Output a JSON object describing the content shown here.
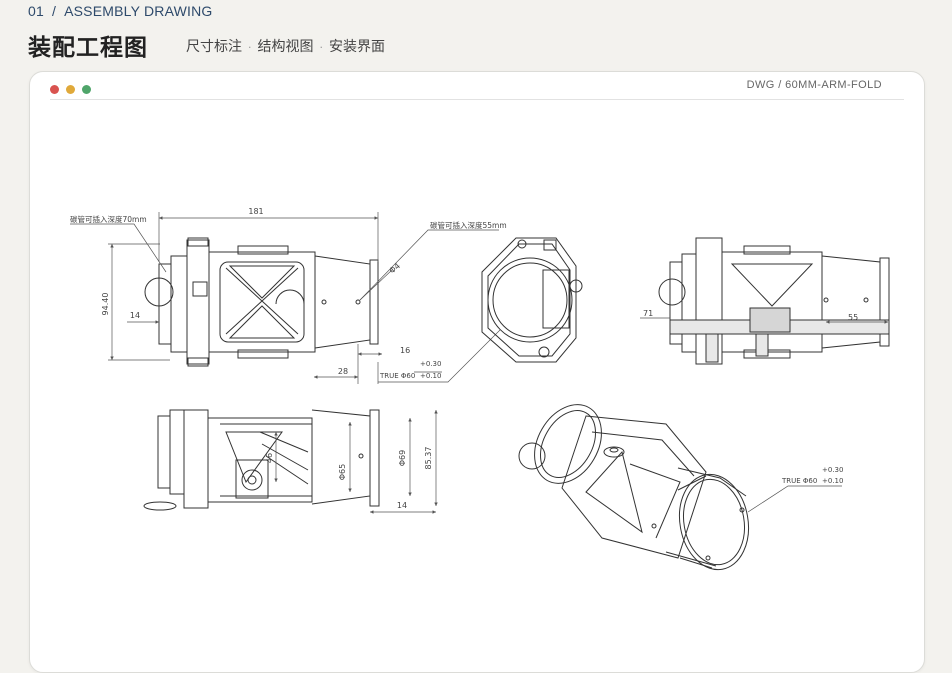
{
  "header": {
    "section_number": "01",
    "separator": "/",
    "section_label": "ASSEMBLY DRAWING",
    "title": "装配工程图",
    "subtitle_items": [
      "尺寸标注",
      "结构视图",
      "安装界面"
    ],
    "subtitle_separator": "·"
  },
  "card": {
    "dwg_label": "DWG / 60MM-ARM-FOLD",
    "window_dot_colors": [
      "#d9534f",
      "#e0a93a",
      "#4fa56a"
    ]
  },
  "drawing": {
    "front": {
      "note_left": "碳管可插入深度70mm",
      "note_right": "碳管可插入深度55mm",
      "dim_length": "181",
      "dim_height": "94.40",
      "dim_flange": "14",
      "dim_hole": "Φ4",
      "dim_16": "16",
      "dim_28": "28",
      "tol_upper": "+0.30",
      "tol_lower": "+0.10",
      "true_dia": "TRUE  Φ60"
    },
    "section": {
      "dim_71": "71",
      "dim_55": "55"
    },
    "bottom": {
      "dim_8537": "85.37",
      "dim_69": "Φ69",
      "dim_65": "Φ65",
      "dim_46": "46",
      "dim_14": "14"
    },
    "iso": {
      "tol_upper": "+0.30",
      "tol_lower": "+0.10",
      "true_dia": "TRUE  Φ60"
    }
  }
}
